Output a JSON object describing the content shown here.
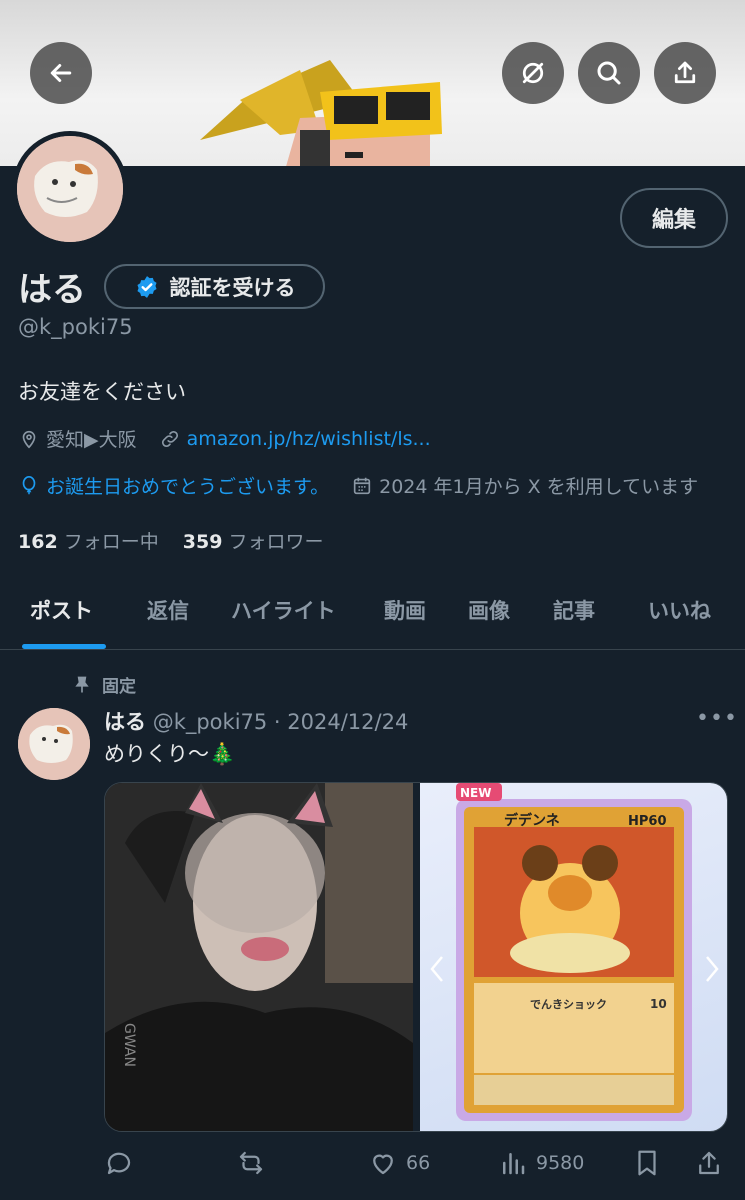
{
  "header": {
    "back_icon": "arrow-left-icon",
    "grok_icon": "slash-circle-icon",
    "search_icon": "search-icon",
    "share_icon": "share-icon"
  },
  "profile": {
    "edit_label": "編集",
    "name": "はる",
    "verify_label": "認証を受ける",
    "handle": "@k_poki75",
    "bio": "お友達をください",
    "location": "愛知▶大阪",
    "link": "amazon.jp/hz/wishlist/ls...",
    "birthday": "お誕生日おめでとうございます。",
    "joined": "2024 年1月から X を利用しています",
    "following_count": "162",
    "following_label": "フォロー中",
    "followers_count": "359",
    "followers_label": "フォロワー"
  },
  "tabs": [
    "ポスト",
    "返信",
    "ハイライト",
    "動画",
    "画像",
    "記事",
    "いいね"
  ],
  "post": {
    "pinned_label": "固定",
    "author_name": "はる",
    "meta": "@k_poki75 · 2024/12/24",
    "text": "めりくり〜🎄",
    "card_badge": "NEW",
    "card_name": "デデンネ",
    "card_hp": "HP60",
    "card_attack": "でんきショック",
    "card_damage": "10",
    "replies": "",
    "reposts": "",
    "likes": "66",
    "views": "9580"
  },
  "colors": {
    "background": "#15202b",
    "accent": "#1d9bf0",
    "muted": "#8b98a5",
    "border": "#536471"
  }
}
